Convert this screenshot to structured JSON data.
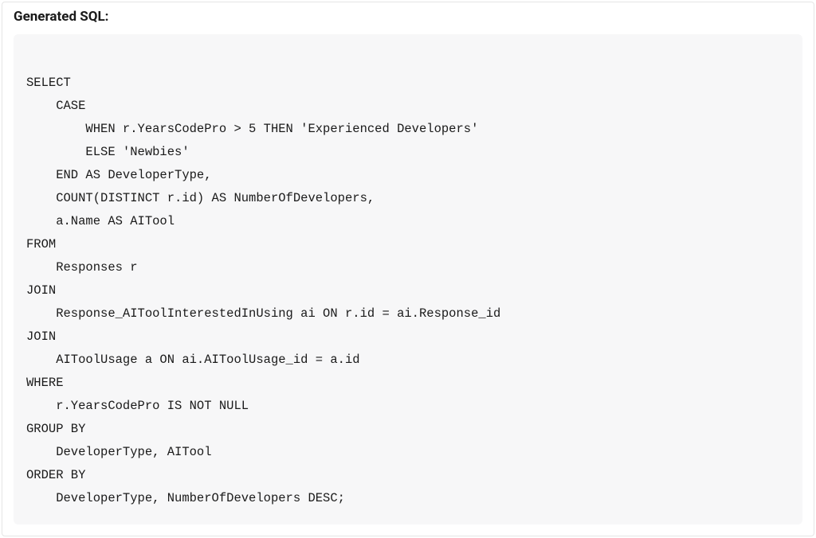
{
  "section": {
    "title": "Generated SQL:"
  },
  "code": {
    "content": "\nSELECT\n    CASE\n        WHEN r.YearsCodePro > 5 THEN 'Experienced Developers'\n        ELSE 'Newbies'\n    END AS DeveloperType,\n    COUNT(DISTINCT r.id) AS NumberOfDevelopers,\n    a.Name AS AITool\nFROM\n    Responses r\nJOIN\n    Response_AIToolInterestedInUsing ai ON r.id = ai.Response_id\nJOIN\n    AIToolUsage a ON ai.AIToolUsage_id = a.id\nWHERE\n    r.YearsCodePro IS NOT NULL\nGROUP BY\n    DeveloperType, AITool\nORDER BY\n    DeveloperType, NumberOfDevelopers DESC;\n"
  }
}
